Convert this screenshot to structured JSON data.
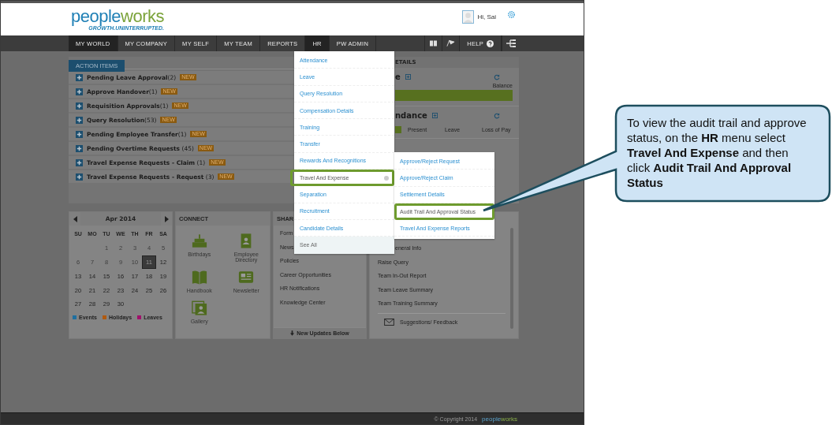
{
  "header": {
    "logo": {
      "wordmark_start": "people",
      "wordmark_end": "works",
      "tagline": "GROWTH.UNINTERRUPTED."
    },
    "greeting": "Hi, Sai"
  },
  "nav": {
    "items": [
      {
        "label": "MY WORLD",
        "selected": true
      },
      {
        "label": "MY COMPANY",
        "selected": false
      },
      {
        "label": "MY SELF",
        "selected": false
      },
      {
        "label": "MY TEAM",
        "selected": false
      },
      {
        "label": "REPORTS",
        "selected": false
      },
      {
        "label": "HR",
        "selected": true
      },
      {
        "label": "PW ADMIN",
        "selected": false
      }
    ],
    "help": "HELP"
  },
  "action_items": {
    "tab": "ACTION ITEMS",
    "rows": [
      {
        "name": "Pending Leave Approval",
        "count": "(2)",
        "badge": "NEW"
      },
      {
        "name": "Approve Handover",
        "count": "(1)",
        "badge": "NEW"
      },
      {
        "name": "Requisition Approvals",
        "count": "(1)",
        "badge": "NEW"
      },
      {
        "name": "Query Resolution",
        "count": "(53)",
        "badge": "NEW"
      },
      {
        "name": "Pending Employee Transfer",
        "count": "(1)",
        "badge": "NEW"
      },
      {
        "name": "Pending Overtime Requests",
        "count": " (45)",
        "badge": "NEW"
      },
      {
        "name": "Travel Expense Requests - Claim",
        "count": " (1)",
        "badge": "NEW"
      },
      {
        "name": "Travel Expense Requests - Request",
        "count": " (3)",
        "badge": "NEW"
      }
    ]
  },
  "details": {
    "title": "ETAILS",
    "leave": {
      "title": "e",
      "column": "Balance"
    },
    "attendance": {
      "title": "ndance",
      "columns": [
        "Present",
        "Leave",
        "Loss of Pay"
      ]
    }
  },
  "calendar": {
    "month": "Apr 2014",
    "weekdays": [
      "SU",
      "MO",
      "TU",
      "WE",
      "TH",
      "FR",
      "SA"
    ],
    "weeks": [
      [
        {
          "kind": "blank"
        },
        {
          "kind": "blank"
        },
        {
          "kind": "day",
          "label": "1",
          "past": true,
          "selected": false
        },
        {
          "kind": "day",
          "label": "2",
          "past": true,
          "selected": false
        },
        {
          "kind": "day",
          "label": "3",
          "past": true,
          "selected": false
        },
        {
          "kind": "day",
          "label": "4",
          "past": true,
          "selected": false
        },
        {
          "kind": "day",
          "label": "5",
          "past": true,
          "selected": false
        }
      ],
      [
        {
          "kind": "day",
          "label": "6",
          "past": true,
          "selected": false
        },
        {
          "kind": "day",
          "label": "7",
          "past": true,
          "selected": false
        },
        {
          "kind": "day",
          "label": "8",
          "past": true,
          "selected": false
        },
        {
          "kind": "day",
          "label": "9",
          "past": true,
          "selected": false
        },
        {
          "kind": "day",
          "label": "10",
          "past": true,
          "selected": false
        },
        {
          "kind": "day",
          "label": "11",
          "past": false,
          "selected": true
        },
        {
          "kind": "day",
          "label": "12",
          "past": false,
          "selected": false
        }
      ],
      [
        {
          "kind": "day",
          "label": "13",
          "past": false,
          "selected": false
        },
        {
          "kind": "day",
          "label": "14",
          "past": false,
          "selected": false
        },
        {
          "kind": "day",
          "label": "15",
          "past": false,
          "selected": false
        },
        {
          "kind": "day",
          "label": "16",
          "past": false,
          "selected": false
        },
        {
          "kind": "day",
          "label": "17",
          "past": false,
          "selected": false
        },
        {
          "kind": "day",
          "label": "18",
          "past": false,
          "selected": false
        },
        {
          "kind": "day",
          "label": "19",
          "past": false,
          "selected": false
        }
      ],
      [
        {
          "kind": "day",
          "label": "20",
          "past": false,
          "selected": false
        },
        {
          "kind": "day",
          "label": "21",
          "past": false,
          "selected": false
        },
        {
          "kind": "day",
          "label": "22",
          "past": false,
          "selected": false
        },
        {
          "kind": "day",
          "label": "23",
          "past": false,
          "selected": false
        },
        {
          "kind": "day",
          "label": "24",
          "past": false,
          "selected": false
        },
        {
          "kind": "day",
          "label": "25",
          "past": false,
          "selected": false
        },
        {
          "kind": "day",
          "label": "26",
          "past": false,
          "selected": false
        }
      ],
      [
        {
          "kind": "day",
          "label": "27",
          "past": false,
          "selected": false
        },
        {
          "kind": "day",
          "label": "28",
          "past": false,
          "selected": false
        },
        {
          "kind": "day",
          "label": "29",
          "past": false,
          "selected": false
        },
        {
          "kind": "day",
          "label": "30",
          "past": false,
          "selected": false
        }
      ]
    ],
    "legend": [
      {
        "label": "Events",
        "color": "#1f6f9f"
      },
      {
        "label": "Holidays",
        "color": "#b05a10"
      },
      {
        "label": "Leaves",
        "color": "#a0106a"
      }
    ]
  },
  "connect": {
    "title": "CONNECT",
    "items": [
      {
        "label": "Birthdays",
        "kind": "cake"
      },
      {
        "label": "Employee Directory",
        "kind": "directory"
      },
      {
        "label": "Handbook",
        "kind": "book"
      },
      {
        "label": "Newsletter",
        "kind": "newspaper"
      },
      {
        "label": "Gallery",
        "kind": "gallery"
      }
    ]
  },
  "shared": {
    "title": "SHAR",
    "items": [
      "Form",
      "News",
      "Policies",
      "Career Opportunities",
      "HR Notifications",
      "Knowledge Center"
    ],
    "footer": "New Updates Below"
  },
  "links": {
    "items": [
      "eneral Info",
      "Raise Query",
      "Team In-Out Report",
      "Team Leave Summary",
      "Team Training Summary"
    ],
    "feedback": "Suggestions/ Feedback"
  },
  "hr_menu": {
    "items": [
      {
        "label": "Attendance",
        "kind": "link",
        "selected": false
      },
      {
        "label": "Leave",
        "kind": "link",
        "selected": false
      },
      {
        "label": "Query Resolution",
        "kind": "link",
        "selected": false
      },
      {
        "label": "Compensation Details",
        "kind": "link",
        "selected": false
      },
      {
        "label": "Training",
        "kind": "link",
        "selected": false
      },
      {
        "label": "Transfer",
        "kind": "link",
        "selected": false
      },
      {
        "label": "Rewards And Recognitions",
        "kind": "link",
        "selected": false
      },
      {
        "label": "Travel And Expense",
        "kind": "submenu",
        "selected": true
      },
      {
        "label": "Separation",
        "kind": "link",
        "selected": false
      },
      {
        "label": "Recruitment",
        "kind": "link",
        "selected": false
      },
      {
        "label": "Candidate Details",
        "kind": "link",
        "selected": false
      },
      {
        "label": "See All",
        "kind": "see_all",
        "selected": false
      }
    ]
  },
  "submenu": {
    "items": [
      {
        "label": "Approve/Reject Request",
        "selected": false
      },
      {
        "label": "Approve/Reject Claim",
        "selected": false
      },
      {
        "label": "Settlement Details",
        "selected": false
      },
      {
        "label": "Audit Trail And Approval Status",
        "selected": true
      },
      {
        "label": "Travel And Expense Reports",
        "selected": false
      }
    ]
  },
  "footer": {
    "copyright": "© Copyright 2014",
    "logo_start": "people",
    "logo_end": "works"
  },
  "callout": {
    "text": "To view the audit trail  and approve status, on the **HR** menu select **Travel And Expense** and then click **Audit Trail And Approval Status**"
  }
}
